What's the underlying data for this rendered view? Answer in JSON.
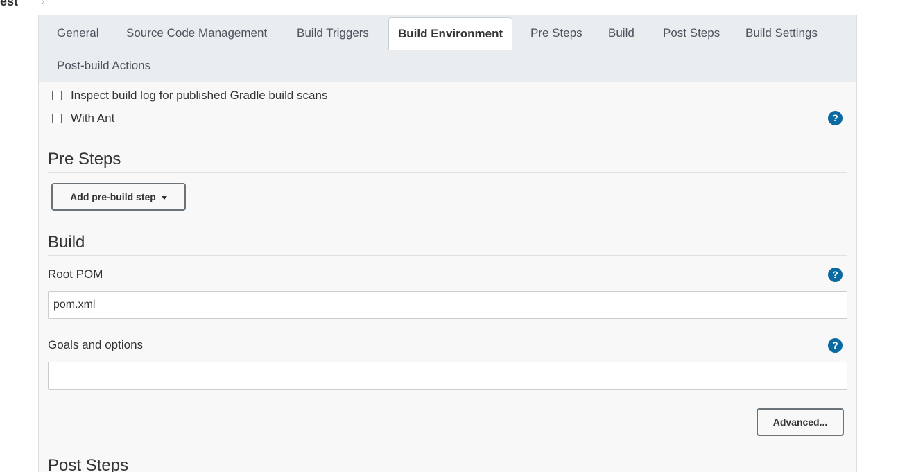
{
  "breadcrumb": {
    "job": "test",
    "separator": "›"
  },
  "tabs": [
    {
      "label": "General"
    },
    {
      "label": "Source Code Management"
    },
    {
      "label": "Build Triggers"
    },
    {
      "label": "Build Environment",
      "active": true
    },
    {
      "label": "Pre Steps"
    },
    {
      "label": "Build"
    },
    {
      "label": "Post Steps"
    },
    {
      "label": "Build Settings"
    },
    {
      "label": "Post-build Actions"
    }
  ],
  "build_environment": {
    "options": [
      {
        "label": "Inspect build log for published Gradle build scans",
        "checked": false
      },
      {
        "label": "With Ant",
        "checked": false
      }
    ]
  },
  "pre_steps": {
    "title": "Pre Steps",
    "add_button": "Add pre-build step"
  },
  "build": {
    "title": "Build",
    "root_pom": {
      "label": "Root POM",
      "value": "pom.xml"
    },
    "goals": {
      "label": "Goals and options",
      "value": ""
    },
    "advanced_button": "Advanced..."
  },
  "post_steps": {
    "title": "Post Steps"
  },
  "help_icon": "?",
  "colors": {
    "accent": "#0b6aa2",
    "tabbar": "#e9edf0",
    "panel": "#f8f8f8"
  }
}
